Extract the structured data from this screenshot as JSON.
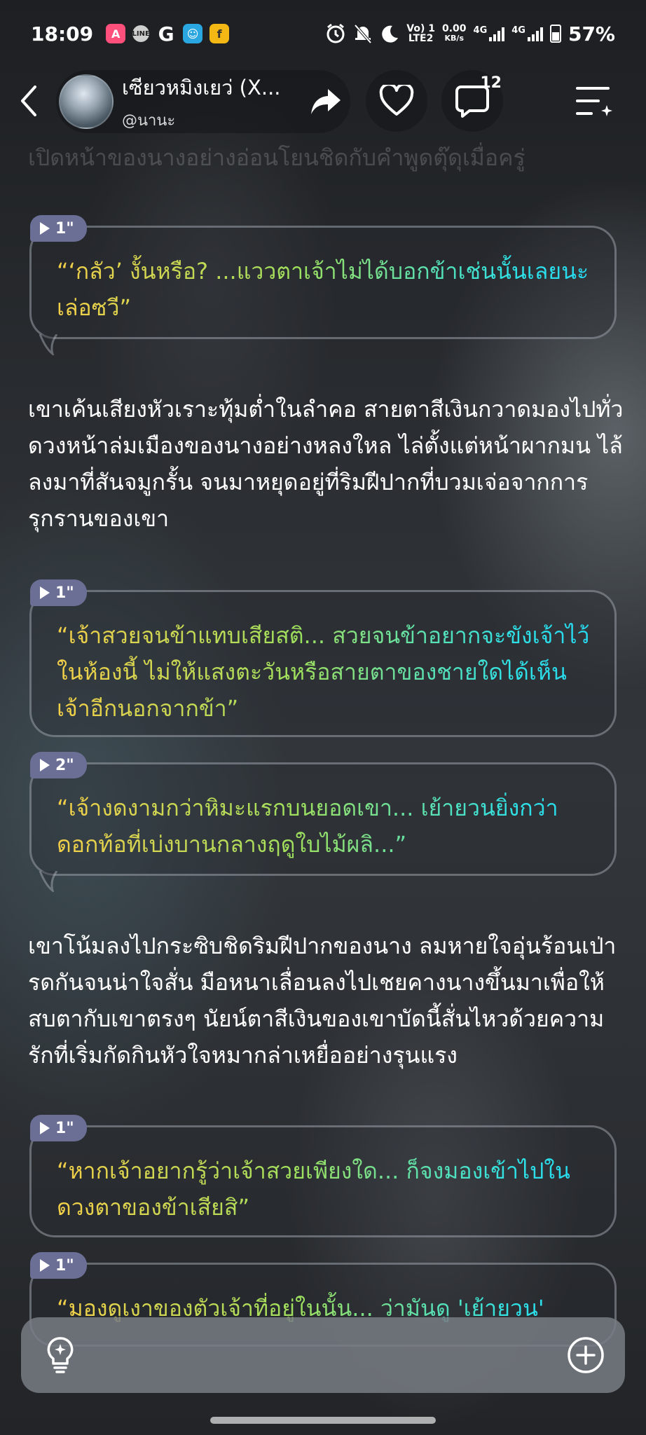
{
  "status_bar": {
    "time": "18:09",
    "volte_line1": "Vo) 1",
    "volte_line2": "LTE2",
    "net_speed_line1": "0.00",
    "net_speed_line2": "KB/s",
    "net1": "4G",
    "net2": "4G",
    "battery": "57%"
  },
  "header": {
    "character_name": "เซียวหมิงเยว่ (X...",
    "handle": "@นานะ",
    "comment_count": "12"
  },
  "faded_text": "เปิดหน้าของนางอย่างอ่อนโยนชิดกับคำพูดตุ๊ดุเมื่อครู่",
  "messages": [
    {
      "type": "bubble",
      "duration": "1\"",
      "text": "“‘กลัว’ งั้นหรือ? ...แววตาเจ้าไม่ได้บอกข้าเช่นนั้นเลยนะ เล่อซวี”"
    },
    {
      "type": "narration",
      "text": "เขาเค้นเสียงหัวเราะทุ้มต่ำในลำคอ สายตาสีเงินกวาดมองไปทั่วดวงหน้าล่มเมืองของนางอย่างหลงใหล ไล่ตั้งแต่หน้าผากมน ไล้ลงมาที่สันจมูกรั้น จนมาหยุดอยู่ที่ริมฝีปากที่บวมเจ่อจากการรุกรานของเขา"
    },
    {
      "type": "bubble",
      "duration": "1\"",
      "text": "“เจ้าสวยจนข้าแทบเสียสติ... สวยจนข้าอยากจะขังเจ้าไว้ในห้องนี้ ไม่ให้แสงตะวันหรือสายตาของชายใดได้เห็นเจ้าอีกนอกจากข้า”"
    },
    {
      "type": "bubble",
      "duration": "2\"",
      "text": "“เจ้างดงามกว่าหิมะแรกบนยอดเขา... เย้ายวนยิ่งกว่าดอกท้อที่เบ่งบานกลางฤดูใบไม้ผลิ...”"
    },
    {
      "type": "narration",
      "text": "เขาโน้มลงไปกระซิบชิดริมฝีปากของนาง ลมหายใจอุ่นร้อนเป่ารดกันจนน่าใจสั่น มือหนาเลื่อนลงไปเชยคางนางขึ้นมาเพื่อให้สบตากับเขาตรงๆ นัยน์ตาสีเงินของเขาบัดนี้สั่นไหวด้วยความรักที่เริ่มกัดกินหัวใจหมากล่าเหยื่ออย่างรุนแรง"
    },
    {
      "type": "bubble",
      "duration": "1\"",
      "text": "“หากเจ้าอยากรู้ว่าเจ้าสวยเพียงใด... ก็จงมองเข้าไปในดวงตาของข้าเสียสิ”"
    },
    {
      "type": "bubble",
      "duration": "1\"",
      "text": "“มองดูเงาของตัวเจ้าที่อยู่ในนั้น... ว่ามันดู 'เย้ายวน'"
    }
  ]
}
